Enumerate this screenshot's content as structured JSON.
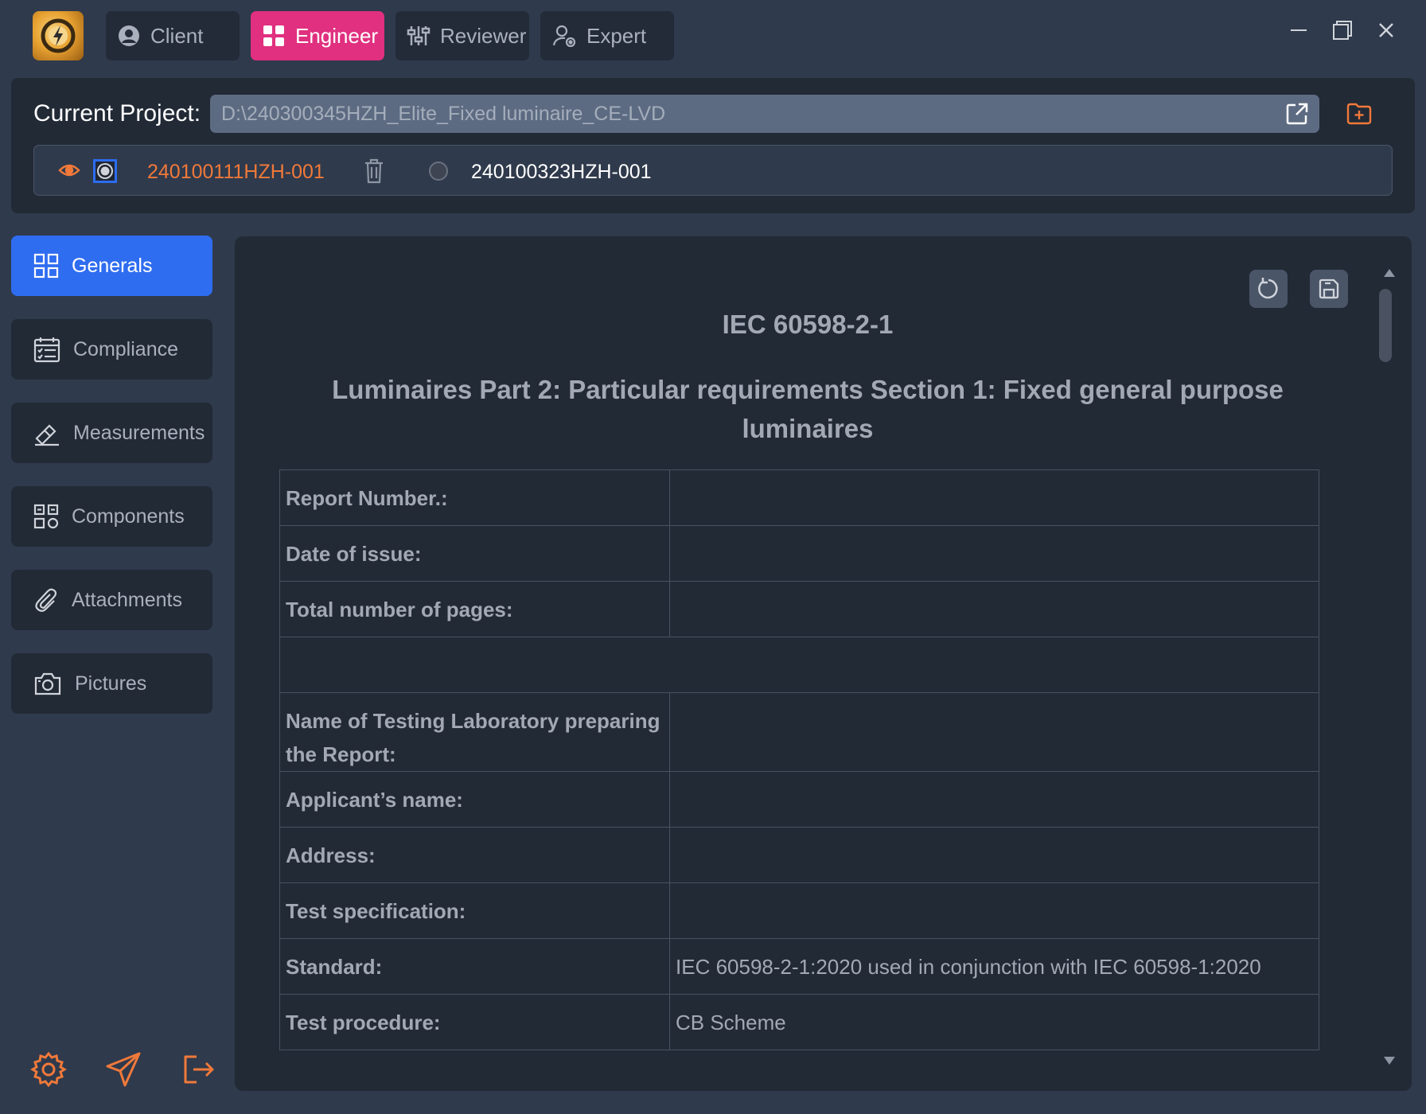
{
  "roles": [
    {
      "label": "Client",
      "icon": "user-circle-icon"
    },
    {
      "label": "Engineer",
      "icon": "grid-icon",
      "active": true
    },
    {
      "label": "Reviewer",
      "icon": "sliders-icon"
    },
    {
      "label": "Expert",
      "icon": "user-gear-icon"
    }
  ],
  "project": {
    "label": "Current Project:",
    "path": "D:\\240300345HZH_Elite_Fixed luminaire_CE-LVD"
  },
  "reports": [
    {
      "id": "240100111HZH-001",
      "selected": true
    },
    {
      "id": "240100323HZH-001",
      "selected": false
    }
  ],
  "sidebar": {
    "items": [
      {
        "label": "Generals",
        "icon": "grid-icon",
        "active": true
      },
      {
        "label": "Compliance",
        "icon": "calendar-check-icon"
      },
      {
        "label": "Measurements",
        "icon": "ruler-pencil-icon"
      },
      {
        "label": "Components",
        "icon": "components-icon"
      },
      {
        "label": "Attachments",
        "icon": "paperclip-icon"
      },
      {
        "label": "Pictures",
        "icon": "camera-icon"
      }
    ]
  },
  "document": {
    "standard": "IEC 60598-2-1",
    "title": "Luminaires Part 2: Particular requirements Section 1: Fixed general purpose luminaires",
    "rows": [
      {
        "key": "Report Number.:",
        "value": ""
      },
      {
        "key": "Date of issue:",
        "value": ""
      },
      {
        "key": "Total number of pages:",
        "value": ""
      },
      {
        "key": "",
        "value": ""
      },
      {
        "key": "Name of Testing Laboratory preparing the Report:",
        "value": ""
      },
      {
        "key": "Applicant’s name:",
        "value": ""
      },
      {
        "key": "Address:",
        "value": ""
      },
      {
        "key": "Test specification:",
        "value": ""
      },
      {
        "key": "Standard:",
        "value": "IEC 60598-2-1:2020 used in conjunction with IEC 60598-1:2020"
      },
      {
        "key": "Test procedure:",
        "value": "CB Scheme"
      }
    ]
  },
  "colors": {
    "accent": "#2f6df0",
    "engineer": "#e0307f",
    "orange": "#f0793a"
  }
}
